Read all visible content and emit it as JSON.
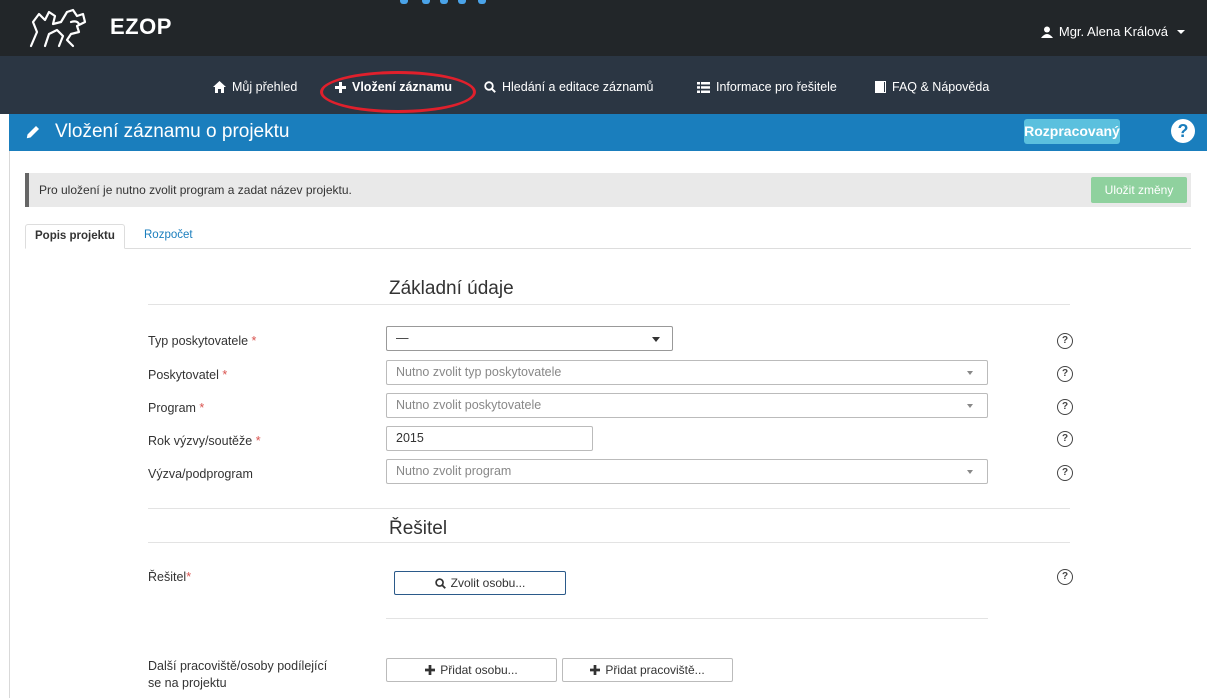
{
  "header": {
    "brand": "EZOP",
    "user_name": "Mgr. Alena Králová"
  },
  "nav": {
    "items": [
      {
        "label": "Můj přehled",
        "icon": "home-icon"
      },
      {
        "label": "Vložení záznamu",
        "icon": "plus-icon",
        "active": true
      },
      {
        "label": "Hledání a editace záznamů",
        "icon": "search-icon"
      },
      {
        "label": "Informace pro řešitele",
        "icon": "list-icon"
      },
      {
        "label": "FAQ & Nápověda",
        "icon": "book-icon"
      }
    ]
  },
  "titlebar": {
    "title": "Vložení záznamu o projektu",
    "status": "Rozpracovaný",
    "help": "?"
  },
  "alert": {
    "text": "Pro uložení je nutno zvolit program a zadat název projektu.",
    "save_label": "Uložit změny"
  },
  "tabs": [
    {
      "label": "Popis projektu",
      "active": true
    },
    {
      "label": "Rozpočet",
      "active": false
    }
  ],
  "basic": {
    "heading": "Základní údaje",
    "fields": [
      {
        "label": "Typ poskytovatele",
        "required": true,
        "value": "—"
      },
      {
        "label": "Poskytovatel",
        "required": true,
        "placeholder": "Nutno zvolit typ poskytovatele"
      },
      {
        "label": "Program",
        "required": true,
        "placeholder": "Nutno zvolit poskytovatele"
      },
      {
        "label": "Rok výzvy/soutěže",
        "required": true,
        "value": "2015"
      },
      {
        "label": "Výzva/podprogram",
        "required": false,
        "placeholder": "Nutno zvolit program"
      }
    ]
  },
  "solver": {
    "heading": "Řešitel",
    "label": "Řešitel",
    "choose_label": "Zvolit osobu..."
  },
  "others": {
    "label_line1": "Další pracoviště/osoby podílející",
    "label_line2": "se na projektu",
    "add_person_label": "Přidat osobu...",
    "add_workplace_label": "Přidat pracoviště..."
  },
  "colors": {
    "titlebar": "#1a7ebd",
    "status_badge": "#5bc0de",
    "save_button": "#8fd19e",
    "highlight": "#e0202c"
  }
}
